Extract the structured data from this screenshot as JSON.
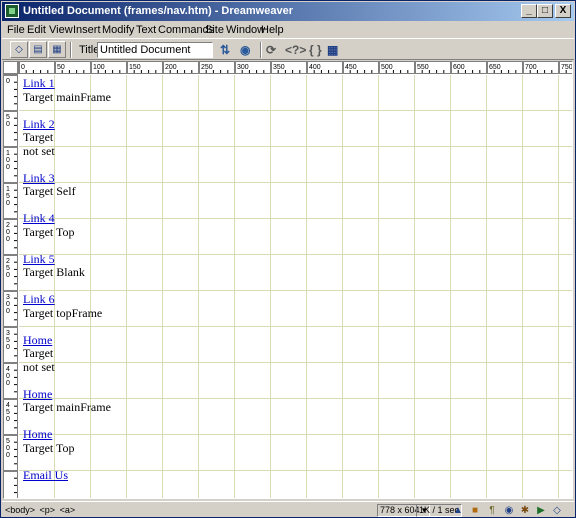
{
  "window": {
    "title": "Untitled Document (frames/nav.htm) - Dreamweaver",
    "min_glyph": "_",
    "max_glyph": "□",
    "close_glyph": "X"
  },
  "menubar": {
    "items": [
      "File",
      "Edit",
      "View",
      "Insert",
      "Modify",
      "Text",
      "Commands",
      "Site",
      "Window",
      "Help"
    ]
  },
  "toolbar": {
    "title_label": "Title:",
    "title_value": "Untitled Document",
    "braces_glyph": "{ }"
  },
  "rulers": {
    "horizontal_ticks": [
      "0",
      "50",
      "100",
      "150",
      "200",
      "250",
      "300",
      "350",
      "400",
      "450",
      "500",
      "550",
      "600",
      "650",
      "700",
      "750"
    ],
    "vertical_ticks": [
      "0",
      "50",
      "100",
      "150",
      "200",
      "250",
      "300",
      "350",
      "400",
      "450",
      "500"
    ]
  },
  "page": {
    "links": [
      {
        "link": "Link 1",
        "target": "Target mainFrame"
      },
      {
        "link": "Link 2",
        "target": "Target",
        "target2": "not set"
      },
      {
        "link": "Link 3",
        "target": "Target Self"
      },
      {
        "link": "Link 4",
        "target": "Target Top"
      },
      {
        "link": "Link 5",
        "target": "Target Blank"
      },
      {
        "link": "Link 6",
        "target": "Target topFrame"
      },
      {
        "link": "Home",
        "target": "Target",
        "target2": "not set"
      },
      {
        "link": "Home",
        "target": "Target mainFrame"
      },
      {
        "link": "Home",
        "target": "Target Top"
      },
      {
        "link": "Email Us",
        "target": ""
      }
    ]
  },
  "statusbar": {
    "tags": [
      "<body>",
      "<p>",
      "<a>"
    ],
    "window_size": "778 x 604",
    "download_stats": "1K / 1 sec"
  },
  "colors": {
    "titlebar_start": "#0a246a",
    "titlebar_end": "#a6caf0",
    "link": "#0000cc",
    "grid": "#d8dcb4"
  },
  "icons": [
    "dreamweaver-app-icon",
    "code-view-icon",
    "split-view-icon",
    "design-view-icon",
    "file-management-icon",
    "preview-browser-icon",
    "refresh-icon",
    "code-navigation-icon",
    "braces-icon",
    "view-options-icon",
    "site-launcher-icon",
    "assets-launcher-icon",
    "html-styles-icon",
    "css-styles-icon",
    "behaviors-icon",
    "history-icon",
    "code-inspector-icon"
  ]
}
